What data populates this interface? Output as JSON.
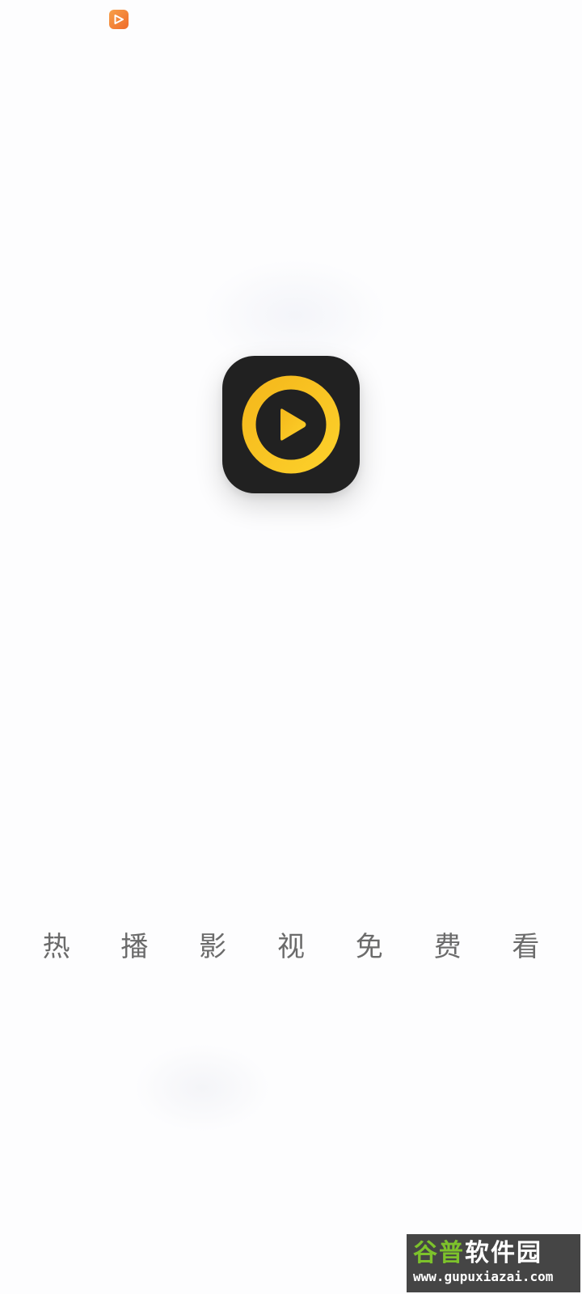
{
  "status_bar": {
    "app_icon": "video-play-notification-icon"
  },
  "splash": {
    "logo_icon": "yellow-ring-play-icon",
    "slogan": "热 播 影 视 免 费 看"
  },
  "watermark": {
    "title_green": "谷普",
    "title_white": "软件园",
    "url": "www.gupuxiazai.com"
  },
  "colors": {
    "background": "#fdfdfe",
    "logo_bg": "#212121",
    "logo_accent": "#f8c21f",
    "status_icon": "#f08a3a",
    "slogan_text": "#6b6b6b"
  }
}
